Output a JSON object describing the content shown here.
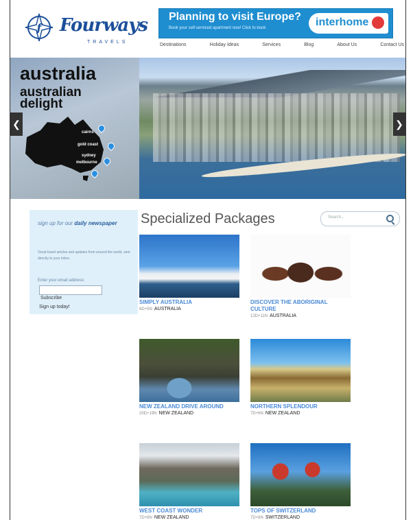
{
  "brand": {
    "name": "Fourways",
    "tagline": "TRAVELS"
  },
  "ad_banner": {
    "headline": "Planning to visit Europe?",
    "subline": "Book your self-serviced apartment now! Click to book",
    "brand": "interhome"
  },
  "nav": [
    "Destinations",
    "Holiday Ideas",
    "Services",
    "Blog",
    "About Us",
    "Contact Us"
  ],
  "hero": {
    "title": "australia",
    "subtitle": "australian delight",
    "cities": [
      "cairns",
      "gold coast",
      "sydney",
      "melbourne"
    ]
  },
  "newsletter": {
    "title_prefix": "sign up for our",
    "title_highlight": "daily newspaper",
    "description": "Great travel articles and updates from around the world, sent directly to your inbox.",
    "email_label": "Enter your email address:",
    "subscribe_label": "Subscribe",
    "signup_today": "Sign up today!"
  },
  "packages": {
    "heading": "Specialized Packages",
    "search_placeholder": "Search...",
    "items": [
      {
        "title": "SIMPLY AUSTRALIA",
        "duration": "6D+5N",
        "country": "AUSTRALIA"
      },
      {
        "title": "DISCOVER THE ABORIGINAL CULTURE",
        "duration": "12D+11N",
        "country": "AUSTRALIA"
      },
      {
        "title": "NEW ZEALAND DRIVE AROUND",
        "duration": "20D+19N",
        "country": "NEW ZEALAND"
      },
      {
        "title": "NORTHERN SPLENDOUR",
        "duration": "7D+6N",
        "country": "NEW ZEALAND"
      },
      {
        "title": "WEST COAST WONDER",
        "duration": "7D+6N",
        "country": "NEW ZEALAND"
      },
      {
        "title": "TOPS OF SWITZERLAND",
        "duration": "7D+6N",
        "country": "SWITZERLAND"
      }
    ]
  },
  "colors": {
    "brand_blue": "#1c4f9a",
    "banner_blue": "#1f8ed0",
    "link_blue": "#4a8ad6",
    "newsletter_bg": "#dff0fb"
  }
}
